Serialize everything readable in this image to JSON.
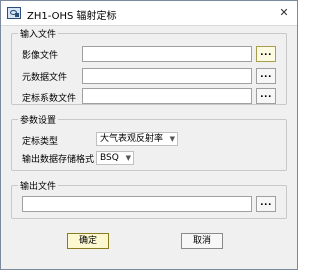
{
  "window": {
    "title": "ZH1-OHS 辐射定标",
    "close_symbol": "✕"
  },
  "input_group": {
    "legend": "输入文件",
    "rows": [
      {
        "label": "影像文件",
        "value": "",
        "browse": "..."
      },
      {
        "label": "元数据文件",
        "value": "",
        "browse": "..."
      },
      {
        "label": "定标系数文件",
        "value": "",
        "browse": "..."
      }
    ]
  },
  "params_group": {
    "legend": "参数设置",
    "calibration_type": {
      "label": "定标类型",
      "selected": "大气表观反射率"
    },
    "output_format": {
      "label": "输出数据存储格式",
      "selected": "BSQ"
    }
  },
  "output_group": {
    "legend": "输出文件",
    "value": "",
    "browse": "..."
  },
  "buttons": {
    "ok": "确定",
    "cancel": "取消"
  }
}
